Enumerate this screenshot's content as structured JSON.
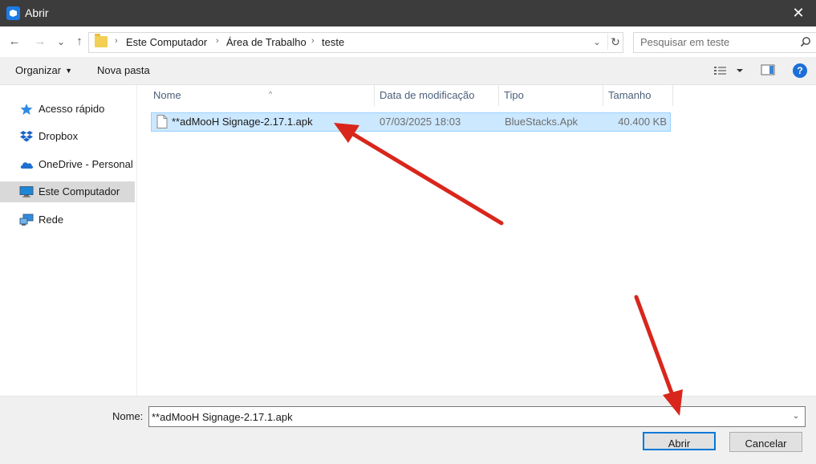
{
  "window": {
    "title": "Abrir",
    "close_glyph": "✕"
  },
  "navigation": {
    "back_glyph": "←",
    "forward_glyph": "→",
    "recent_glyph": "⌄",
    "up_glyph": "↑",
    "breadcrumb": [
      "Este Computador",
      "Área de Trabalho",
      "teste"
    ],
    "separator": "›",
    "search_placeholder": "Pesquisar em teste",
    "refresh_glyph": "↻",
    "dropdown_glyph": "⌄"
  },
  "toolbar": {
    "organize_label": "Organizar",
    "new_folder_label": "Nova pasta",
    "help_label": "?"
  },
  "sidebar": {
    "items": [
      {
        "label": "Acesso rápido",
        "icon": "star-icon"
      },
      {
        "label": "Dropbox",
        "icon": "dropbox-icon"
      },
      {
        "label": "OneDrive - Personal",
        "icon": "cloud-icon"
      },
      {
        "label": "Este Computador",
        "icon": "computer-icon",
        "selected": true
      },
      {
        "label": "Rede",
        "icon": "network-icon"
      }
    ]
  },
  "file_list": {
    "columns": [
      "Nome",
      "Data de modificação",
      "Tipo",
      "Tamanho"
    ],
    "sort_glyph": "^",
    "rows": [
      {
        "name": "**adMooH Signage-2.17.1.apk",
        "modified": "07/03/2025 18:03",
        "type": "BlueStacks.Apk",
        "size": "40.400 KB",
        "selected": true
      }
    ]
  },
  "footer": {
    "filename_label": "Nome:",
    "filename_value": "**adMooH Signage-2.17.1.apk",
    "dropdown_glyph": "⌄",
    "open_label": "Abrir",
    "cancel_label": "Cancelar"
  },
  "colors": {
    "title_bar": "#3c3c3c",
    "selection": "#cce8ff",
    "accent": "#0078d7",
    "annotation_arrow": "#d9261c"
  }
}
